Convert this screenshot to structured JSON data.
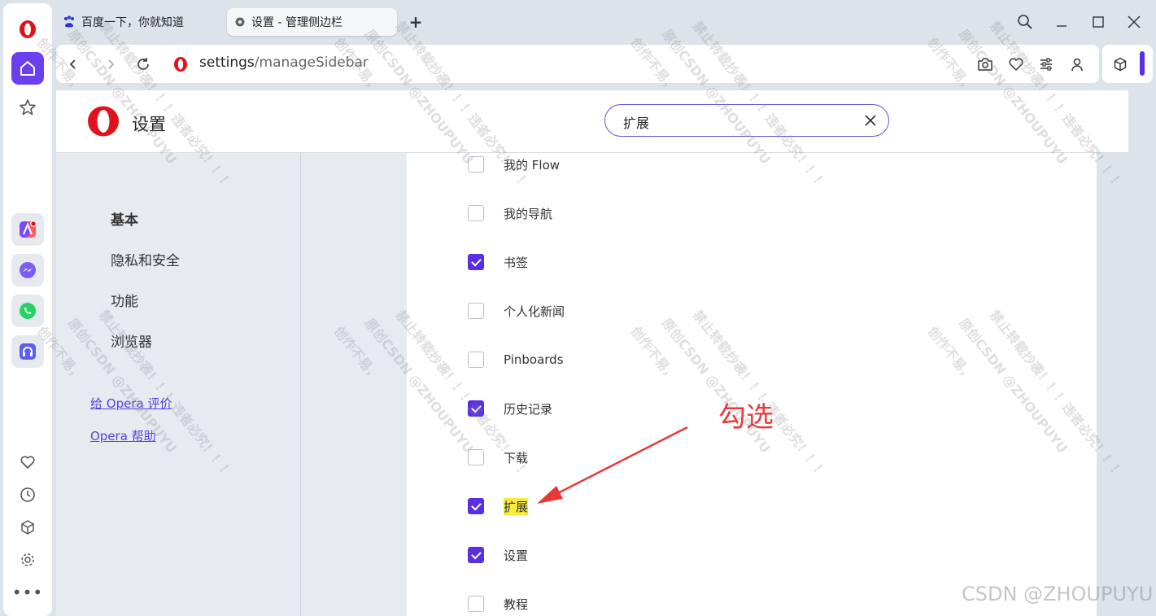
{
  "tabs": [
    {
      "title": "百度一下，你就知道",
      "icon": "baidu-paw-icon"
    },
    {
      "title": "设置 - 管理侧边栏",
      "icon": "gear-icon"
    }
  ],
  "address": {
    "url_host": "settings",
    "url_path": "/manageSidebar"
  },
  "settings": {
    "title": "设置",
    "search_value": "扩展",
    "nav": [
      "基本",
      "隐私和安全",
      "功能",
      "浏览器"
    ],
    "links": [
      "给 Opera 评价",
      "Opera 帮助"
    ]
  },
  "sidebar_options": [
    {
      "label": "我的 Flow",
      "checked": false
    },
    {
      "label": "我的导航",
      "checked": false
    },
    {
      "label": "书签",
      "checked": true
    },
    {
      "label": "个人化新闻",
      "checked": false
    },
    {
      "label": "Pinboards",
      "checked": false
    },
    {
      "label": "历史记录",
      "checked": true
    },
    {
      "label": "下载",
      "checked": false
    },
    {
      "label": "扩展",
      "checked": true,
      "highlight": true
    },
    {
      "label": "设置",
      "checked": true
    },
    {
      "label": "教程",
      "checked": false
    }
  ],
  "annotation": {
    "text": "勾选",
    "color": "#e8393a"
  },
  "watermark": {
    "line1": "创作不易，",
    "line2": "原创CSDN @ZHOUPUYU",
    "line3": "禁止转载抄袭！！！违者必究！！！",
    "footer": "CSDN @ZHOUPUYU"
  },
  "colors": {
    "accent": "#5a2ee3",
    "opera_red": "#e0131c",
    "link": "#5b3fd9"
  }
}
